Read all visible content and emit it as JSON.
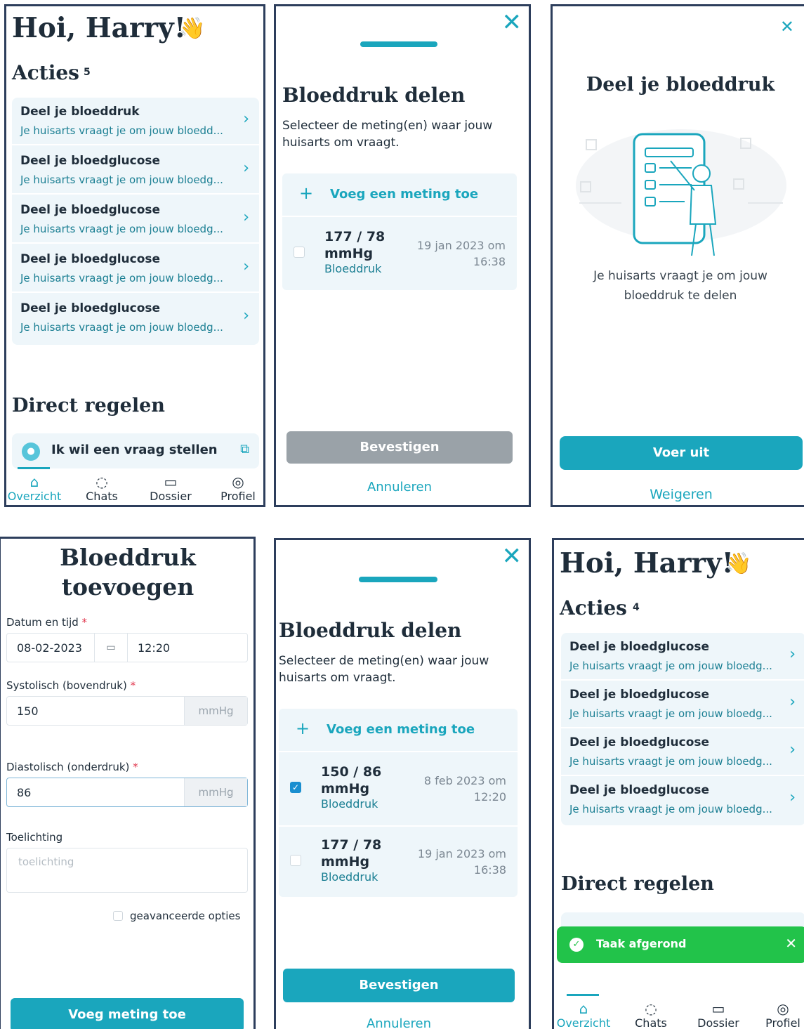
{
  "screen1": {
    "greeting": "Hoi, Harry!",
    "hand_icon": "👋",
    "actions_heading": "Acties",
    "actions_count": "5",
    "actions": [
      {
        "title": "Deel je bloeddruk",
        "subtitle": "Je huisarts vraagt je om jouw bloedd..."
      },
      {
        "title": "Deel je bloedglucose",
        "subtitle": "Je huisarts vraagt je om jouw bloedg..."
      },
      {
        "title": "Deel je bloedglucose",
        "subtitle": "Je huisarts vraagt je om jouw bloedg..."
      },
      {
        "title": "Deel je bloedglucose",
        "subtitle": "Je huisarts vraagt je om jouw bloedg..."
      },
      {
        "title": "Deel je bloedglucose",
        "subtitle": "Je huisarts vraagt je om jouw bloedg..."
      }
    ],
    "direct_heading": "Direct regelen",
    "direct_button": "Ik wil een vraag stellen",
    "tabs": [
      "Overzicht",
      "Chats",
      "Dossier",
      "Profiel"
    ]
  },
  "screen2": {
    "title": "Bloeddruk delen",
    "description": "Selecteer de meting(en) waar jouw huisarts om vraagt.",
    "add_label": "Voeg een meting toe",
    "measurement": {
      "value_line1": "177 / 78",
      "value_line2": "mmHg",
      "type": "Bloeddruk",
      "date_line1": "19 jan 2023 om",
      "date_line2": "16:38"
    },
    "confirm": "Bevestigen",
    "cancel": "Annuleren"
  },
  "screen3": {
    "title": "Deel je bloeddruk",
    "message_line1": "Je huisarts vraagt je om jouw",
    "message_line2": "bloeddruk te delen",
    "primary": "Voer uit",
    "secondary": "Weigeren"
  },
  "screen4": {
    "title_line1": "Bloeddruk",
    "title_line2": "toevoegen",
    "datetime_label": "Datum en tijd",
    "date_value": "08-02-2023",
    "time_value": "12:20",
    "systolic_label": "Systolisch (bovendruk)",
    "systolic_value": "150",
    "diastolic_label": "Diastolisch (onderdruk)",
    "diastolic_value": "86",
    "unit": "mmHg",
    "note_label": "Toelichting",
    "note_placeholder": "toelichting",
    "advanced_label": "geavanceerde opties",
    "submit": "Voeg meting toe",
    "required_mark": "*"
  },
  "screen5": {
    "title": "Bloeddruk delen",
    "description": "Selecteer de meting(en) waar jouw huisarts om vraagt.",
    "add_label": "Voeg een meting toe",
    "measurements": [
      {
        "value_line1": "150 / 86",
        "value_line2": "mmHg",
        "type": "Bloeddruk",
        "date_line1": "8 feb 2023 om",
        "date_line2": "12:20",
        "checked": true
      },
      {
        "value_line1": "177 / 78",
        "value_line2": "mmHg",
        "type": "Bloeddruk",
        "date_line1": "19 jan 2023 om",
        "date_line2": "16:38",
        "checked": false
      }
    ],
    "confirm": "Bevestigen",
    "cancel": "Annuleren"
  },
  "screen6": {
    "greeting": "Hoi, Harry!",
    "hand_icon": "👋",
    "actions_heading": "Acties",
    "actions_count": "4",
    "actions": [
      {
        "title": "Deel je bloedglucose",
        "subtitle": "Je huisarts vraagt je om jouw bloedg..."
      },
      {
        "title": "Deel je bloedglucose",
        "subtitle": "Je huisarts vraagt je om jouw bloedg..."
      },
      {
        "title": "Deel je bloedglucose",
        "subtitle": "Je huisarts vraagt je om jouw bloedg..."
      },
      {
        "title": "Deel je bloedglucose",
        "subtitle": "Je huisarts vraagt je om jouw bloedg..."
      }
    ],
    "direct_heading": "Direct regelen",
    "toast": "Taak afgerond",
    "tabs": [
      "Overzicht",
      "Chats",
      "Dossier",
      "Profiel"
    ]
  },
  "colors": {
    "accent": "#1aa6bd",
    "text": "#1f2d3a",
    "card": "#eef6fa",
    "success": "#22c34a",
    "disabled": "#9aa2a8"
  }
}
